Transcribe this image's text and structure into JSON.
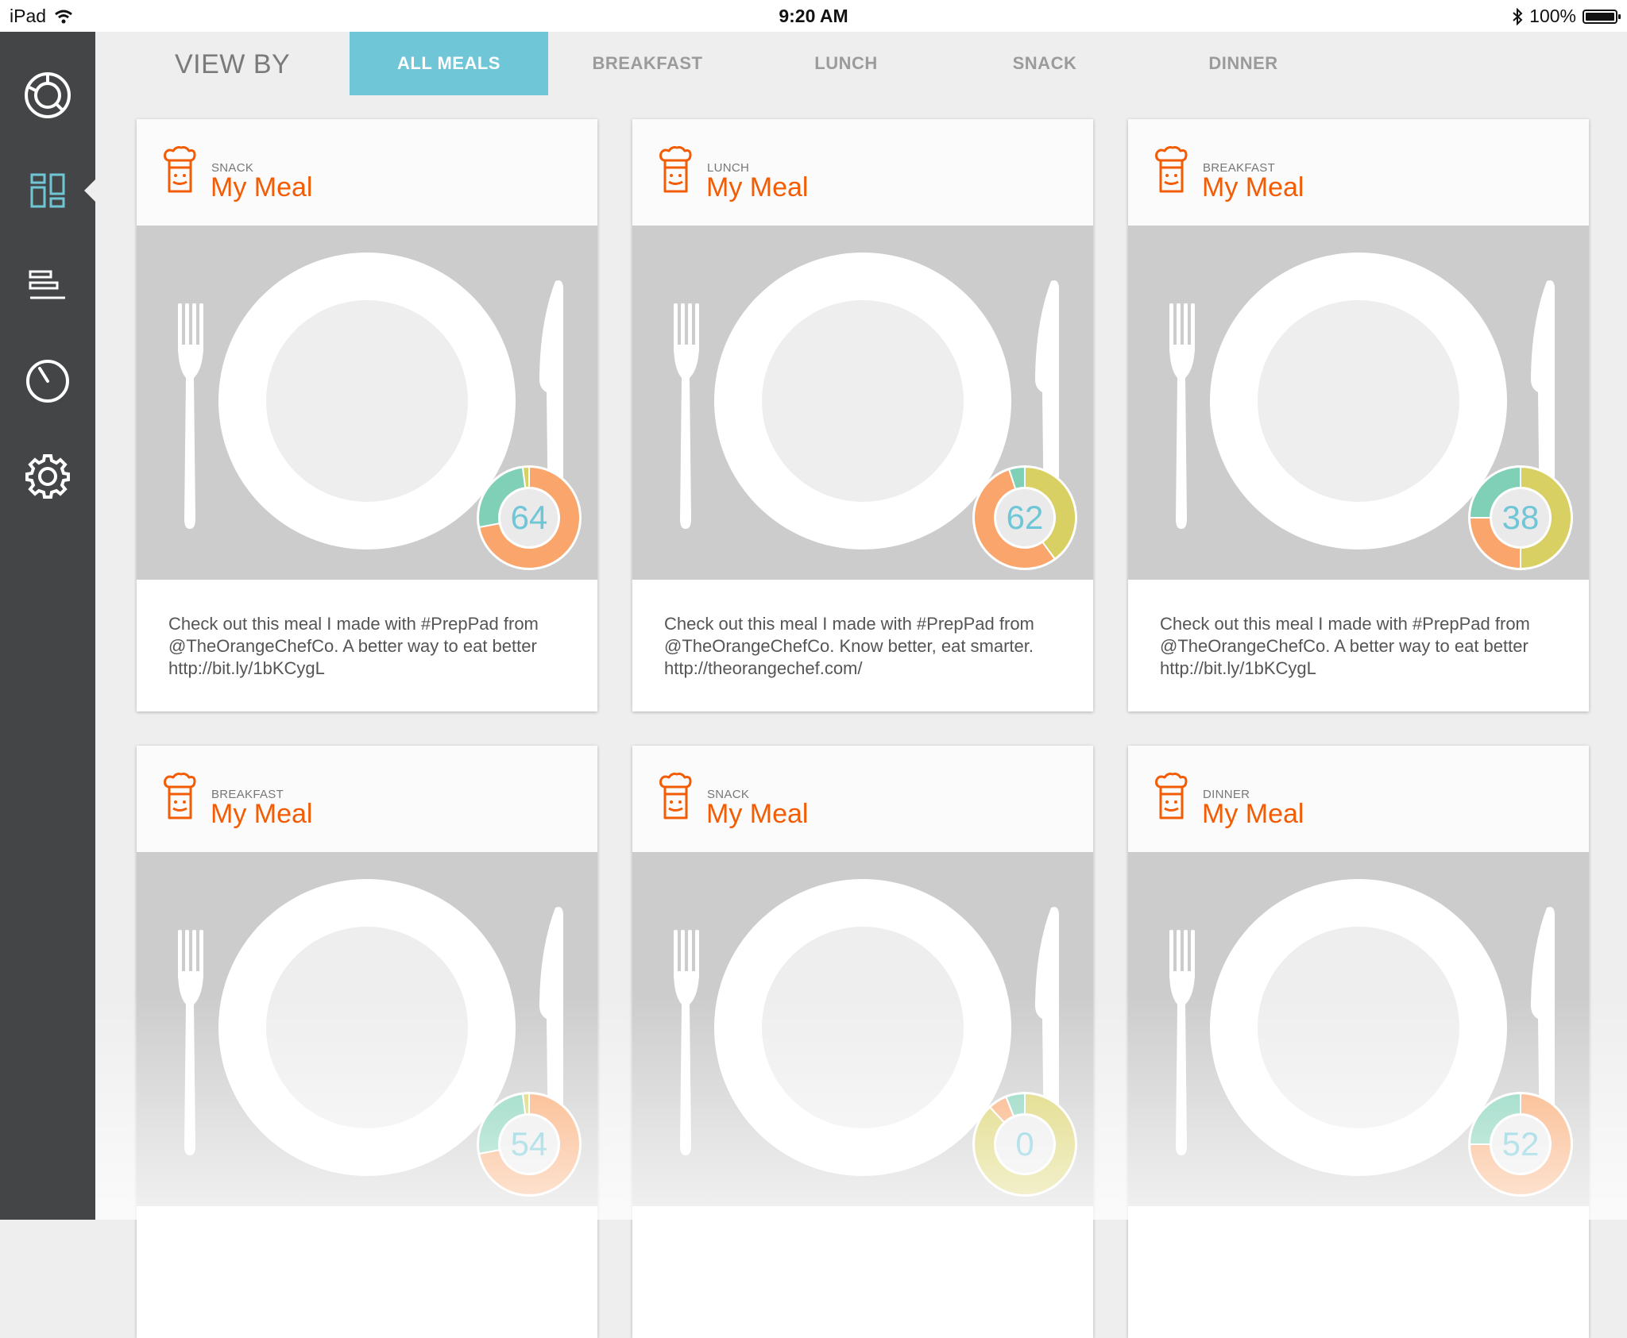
{
  "status_bar": {
    "device": "iPad",
    "time": "9:20 AM",
    "battery": "100%"
  },
  "sidebar": {
    "items": [
      {
        "icon": "dashboard-ring-icon"
      },
      {
        "icon": "grid-icon"
      },
      {
        "icon": "list-bars-icon"
      },
      {
        "icon": "timer-icon"
      },
      {
        "icon": "gear-icon"
      }
    ]
  },
  "filter": {
    "label": "VIEW BY",
    "tabs": [
      "ALL MEALS",
      "BREAKFAST",
      "LUNCH",
      "SNACK",
      "DINNER"
    ],
    "active": "ALL MEALS"
  },
  "colors": {
    "accent": "#6fc6d6",
    "brand": "#f25c05",
    "sidebar": "#444546",
    "ring_orange": "#f9a56b",
    "ring_green": "#7fd0b6",
    "ring_yellow": "#d8d062"
  },
  "cards": [
    {
      "type": "SNACK",
      "title": "My Meal",
      "score": "64",
      "caption": "Check out this meal I made with #PrepPad from @TheOrangeChefCo. A better way to eat better http://bit.ly/1bKCygL",
      "ring": [
        {
          "color": "#f9a56b",
          "value": 0.72
        },
        {
          "color": "#7fd0b6",
          "value": 0.26
        },
        {
          "color": "#d8d062",
          "value": 0.02
        }
      ]
    },
    {
      "type": "LUNCH",
      "title": "My Meal",
      "score": "62",
      "caption": "Check out this meal I made with #PrepPad from @TheOrangeChefCo. Know better, eat smarter. http://theorangechef.com/",
      "ring": [
        {
          "color": "#d8d062",
          "value": 0.4
        },
        {
          "color": "#f9a56b",
          "value": 0.55
        },
        {
          "color": "#7fd0b6",
          "value": 0.05
        }
      ]
    },
    {
      "type": "BREAKFAST",
      "title": "My Meal",
      "score": "38",
      "caption": "Check out this meal I made with #PrepPad from @TheOrangeChefCo. A better way to eat better http://bit.ly/1bKCygL",
      "ring": [
        {
          "color": "#d8d062",
          "value": 0.5
        },
        {
          "color": "#f9a56b",
          "value": 0.25
        },
        {
          "color": "#7fd0b6",
          "value": 0.25
        }
      ]
    },
    {
      "type": "BREAKFAST",
      "title": "My Meal",
      "score": "54",
      "caption": "",
      "ring": [
        {
          "color": "#f9a56b",
          "value": 0.72
        },
        {
          "color": "#7fd0b6",
          "value": 0.26
        },
        {
          "color": "#d8d062",
          "value": 0.02
        }
      ]
    },
    {
      "type": "SNACK",
      "title": "My Meal",
      "score": "0",
      "caption": "",
      "ring": [
        {
          "color": "#d8d062",
          "value": 0.88
        },
        {
          "color": "#f9a56b",
          "value": 0.06
        },
        {
          "color": "#7fd0b6",
          "value": 0.06
        }
      ]
    },
    {
      "type": "DINNER",
      "title": "My Meal",
      "score": "52",
      "caption": "",
      "ring": [
        {
          "color": "#f9a56b",
          "value": 0.75
        },
        {
          "color": "#7fd0b6",
          "value": 0.25
        }
      ]
    }
  ]
}
